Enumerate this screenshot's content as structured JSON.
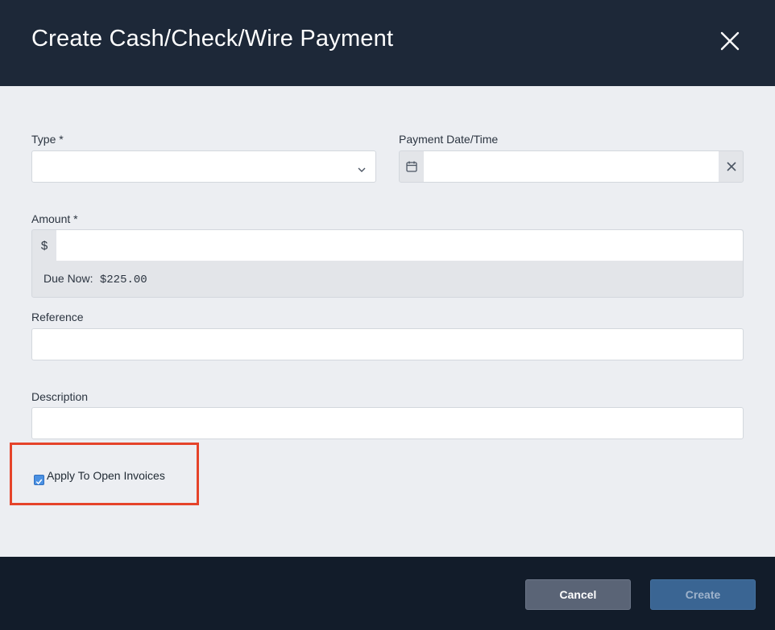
{
  "dialog": {
    "title": "Create Cash/Check/Wire Payment"
  },
  "form": {
    "type": {
      "label": "Type *",
      "value": ""
    },
    "payment_date": {
      "label": "Payment Date/Time",
      "value": ""
    },
    "amount": {
      "label": "Amount *",
      "currency_symbol": "$",
      "value": "",
      "due_now_label": "Due Now:",
      "due_now_value": "$225.00"
    },
    "reference": {
      "label": "Reference",
      "value": ""
    },
    "description": {
      "label": "Description",
      "value": ""
    },
    "apply_to_open_invoices": {
      "label": "Apply To Open Invoices",
      "checked": true
    }
  },
  "footer": {
    "cancel_label": "Cancel",
    "create_label": "Create"
  },
  "colors": {
    "header_bg": "#1d2838",
    "body_bg": "#eceef2",
    "footer_bg": "#121c2a",
    "highlight_border": "#e5432a",
    "checkbox_accent": "#4a90e2"
  }
}
